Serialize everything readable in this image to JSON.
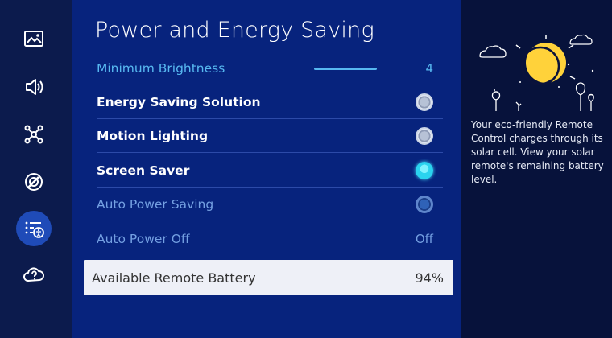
{
  "sidebar": {
    "items": [
      {
        "name": "picture",
        "icon": "picture-icon"
      },
      {
        "name": "sound",
        "icon": "sound-icon"
      },
      {
        "name": "connection",
        "icon": "connection-icon"
      },
      {
        "name": "support",
        "icon": "support-icon"
      },
      {
        "name": "general-accessibility",
        "icon": "general-accessibility-icon",
        "active": true
      },
      {
        "name": "cloud-support",
        "icon": "cloud-help-icon"
      }
    ]
  },
  "panel": {
    "title": "Power and Energy Saving",
    "rows": [
      {
        "label": "Minimum Brightness",
        "value": "4"
      },
      {
        "label": "Energy Saving Solution",
        "state": "off"
      },
      {
        "label": "Motion Lighting",
        "state": "off"
      },
      {
        "label": "Screen Saver",
        "state": "on"
      },
      {
        "label": "Auto Power Saving",
        "state": "off"
      },
      {
        "label": "Auto Power Off",
        "value": "Off"
      }
    ],
    "battery": {
      "label": "Available Remote Battery",
      "value": "94%"
    }
  },
  "info": {
    "text": "Your eco-friendly Remote Control charges through its solar cell. View your solar remote's remaining battery level."
  },
  "colors": {
    "panel_bg": "#07237d",
    "sidebar_bg": "#0c1b4d",
    "info_bg": "#07123b",
    "accent": "#57b8f0",
    "toggle_on": "#2ad3ef"
  }
}
